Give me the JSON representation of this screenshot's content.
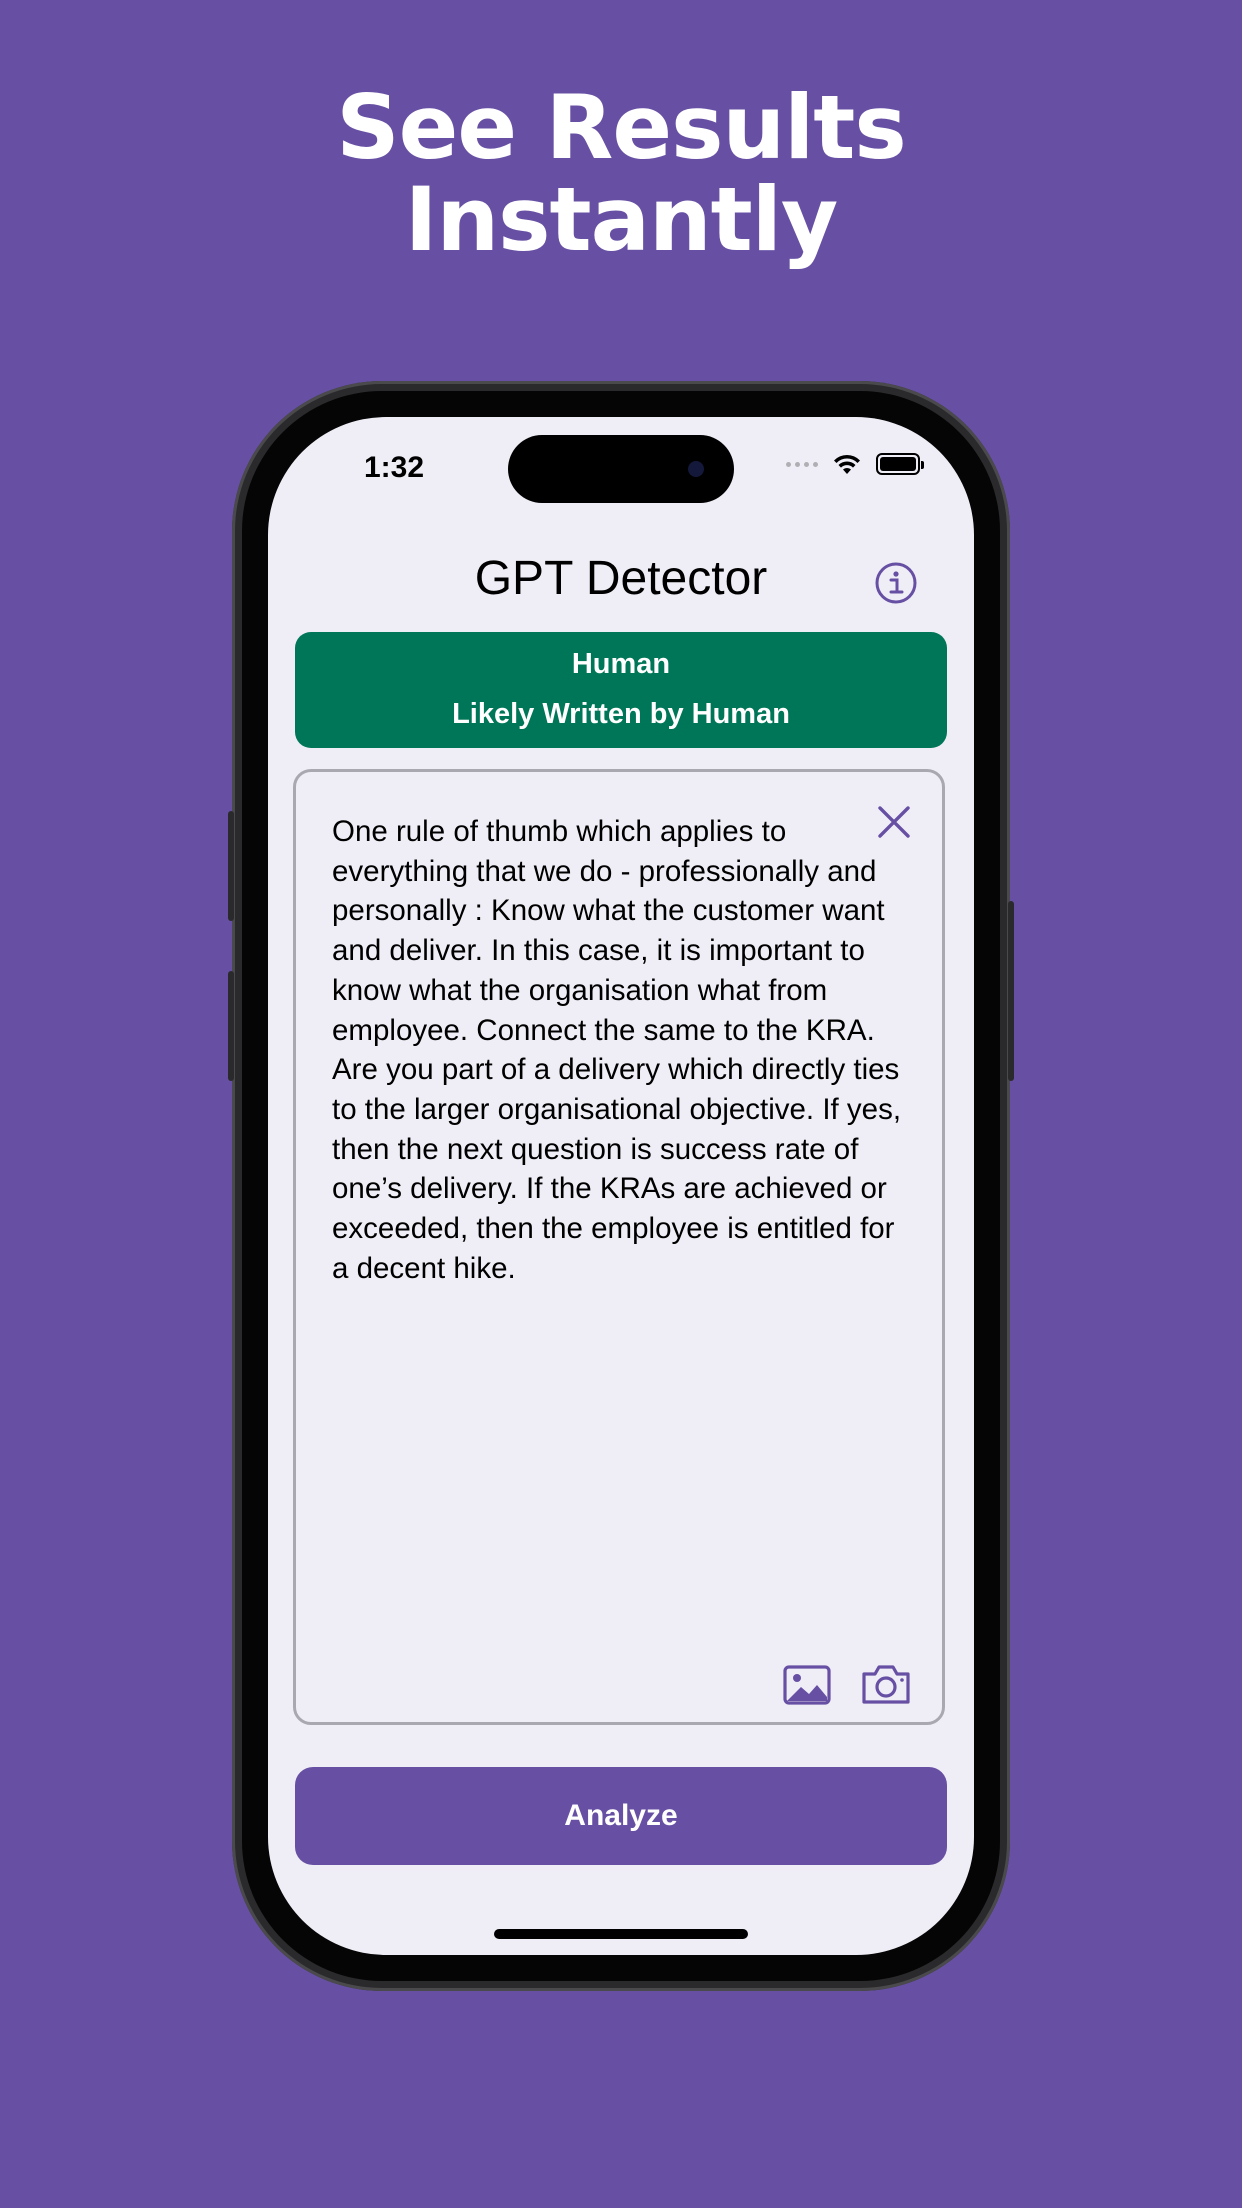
{
  "headline": {
    "line1": "See Results",
    "line2": "Instantly"
  },
  "status_bar": {
    "time": "1:32"
  },
  "app": {
    "title": "GPT Detector",
    "result": {
      "label": "Human",
      "detail": "Likely Written by Human",
      "color": "#007658"
    },
    "input_text": "One rule of thumb which applies to everything that we do - professionally and personally : Know what the customer want and deliver. In this case, it is important to know what the organisation what from employee. Connect the same to the KRA. Are you part of a delivery which directly ties to the larger organisational objective. If yes, then the next question is success rate of one’s delivery. If the KRAs are achieved or exceeded, then the employee is entitled for a decent hike.",
    "analyze_label": "Analyze",
    "icons": [
      "info-icon",
      "close-icon",
      "image-icon",
      "camera-icon",
      "wifi-icon",
      "battery-icon"
    ]
  },
  "colors": {
    "brand": "#6750a4",
    "result_green": "#007658",
    "screen_bg": "#efeef6"
  }
}
